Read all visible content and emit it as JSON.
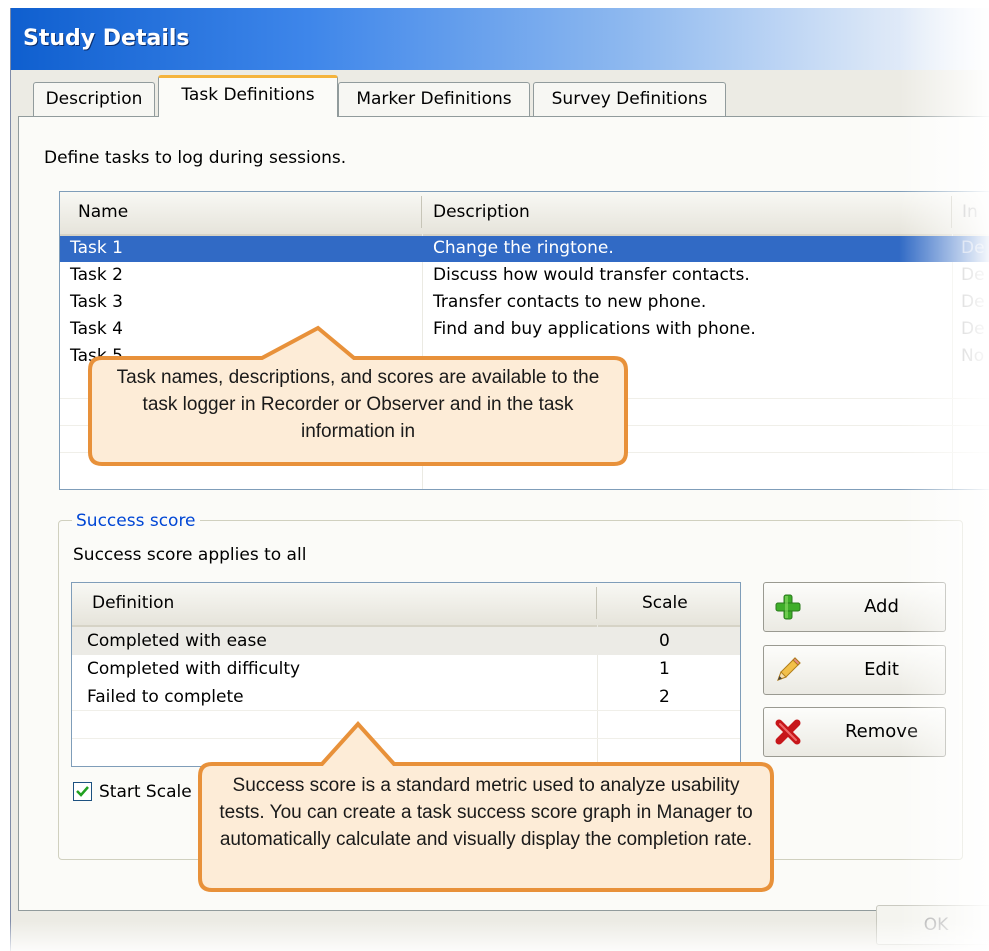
{
  "window": {
    "title": "Study Details"
  },
  "tabs": [
    {
      "label": "Description",
      "active": false
    },
    {
      "label": "Task Definitions",
      "active": true
    },
    {
      "label": "Marker Definitions",
      "active": false
    },
    {
      "label": "Survey Definitions",
      "active": false
    }
  ],
  "intro_text": "Define tasks to log during sessions.",
  "tasks": {
    "columns": [
      "Name",
      "Description",
      "In"
    ],
    "rows": [
      {
        "name": "Task 1",
        "description": "Change the ringtone.",
        "col3": "De",
        "selected": true
      },
      {
        "name": "Task 2",
        "description": "Discuss how would transfer contacts.",
        "col3": "De",
        "selected": false
      },
      {
        "name": "Task 3",
        "description": "Transfer contacts to new phone.",
        "col3": "De",
        "selected": false
      },
      {
        "name": "Task 4",
        "description": "Find and buy applications with phone.",
        "col3": "De",
        "selected": false
      },
      {
        "name": "Task 5",
        "description": "",
        "col3": "No",
        "selected": false
      }
    ]
  },
  "success_score": {
    "legend": "Success score",
    "applies_text": "Success score applies to all",
    "columns": [
      "Definition",
      "Scale"
    ],
    "rows": [
      {
        "definition": "Completed with ease",
        "scale": "0"
      },
      {
        "definition": "Completed with difficulty",
        "scale": "1"
      },
      {
        "definition": "Failed to complete",
        "scale": "2"
      }
    ],
    "buttons": {
      "add": "Add",
      "edit": "Edit",
      "remove": "Remove"
    },
    "checkbox_label": "Start Scale at 0",
    "checkbox_checked": true
  },
  "footer": {
    "ok": "OK"
  },
  "callouts": {
    "tasks": "Task names, descriptions, and scores are available to the task logger in Recorder or Observer and in the task information in",
    "score": "Success score is a standard metric used to analyze usability tests. You can create a task success score graph in Manager to automatically calculate and visually display the completion rate."
  },
  "colors": {
    "selection": "#316ac5",
    "title_bar": "#0f5fcf",
    "active_tab_accent": "#f5b43d",
    "callout_fill": "#fdecd7",
    "callout_border": "#e8913a",
    "legend_text": "#0046d5"
  }
}
